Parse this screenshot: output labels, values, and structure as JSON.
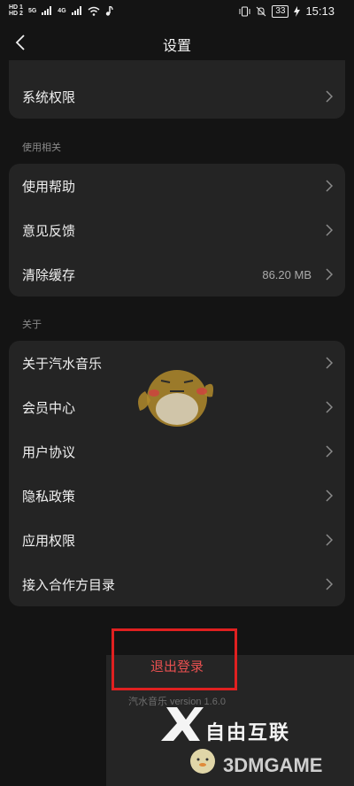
{
  "status_bar": {
    "hd1": "HD 1",
    "hd2": "HD 2",
    "net1": "5G",
    "net2": "4G",
    "battery": "33",
    "time": "15:13"
  },
  "header": {
    "title": "设置"
  },
  "groups": [
    {
      "section_title": "",
      "items": [
        {
          "label": "系统权限",
          "value": ""
        }
      ]
    },
    {
      "section_title": "使用相关",
      "items": [
        {
          "label": "使用帮助",
          "value": ""
        },
        {
          "label": "意见反馈",
          "value": ""
        },
        {
          "label": "清除缓存",
          "value": "86.20 MB"
        }
      ]
    },
    {
      "section_title": "关于",
      "items": [
        {
          "label": "关于汽水音乐",
          "value": ""
        },
        {
          "label": "会员中心",
          "value": ""
        },
        {
          "label": "用户协议",
          "value": ""
        },
        {
          "label": "隐私政策",
          "value": ""
        },
        {
          "label": "应用权限",
          "value": ""
        },
        {
          "label": "接入合作方目录",
          "value": ""
        }
      ]
    }
  ],
  "footer": {
    "logout_label": "退出登录",
    "version": "汽水音乐 version 1.6.0"
  },
  "watermark": {
    "brand_text": "自由互联",
    "game_text": "3DMGAME"
  },
  "colors": {
    "background": "#141414",
    "card": "#242424",
    "logout": "#e85050"
  }
}
